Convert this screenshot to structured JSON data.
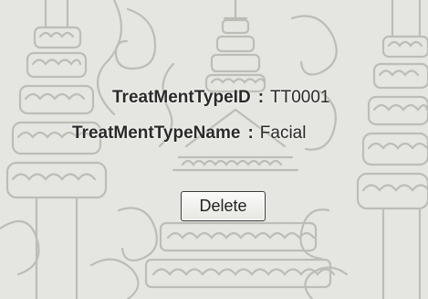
{
  "record": {
    "id_label": "TreatMentTypeID",
    "id_value": "TT0001",
    "name_label": "TreatMentTypeName",
    "name_value": "Facial",
    "colon": ":"
  },
  "actions": {
    "delete_label": "Delete"
  },
  "colors": {
    "background": "#e5e5e1",
    "pattern": "#bdbdb8",
    "text": "#2a2a2a"
  }
}
